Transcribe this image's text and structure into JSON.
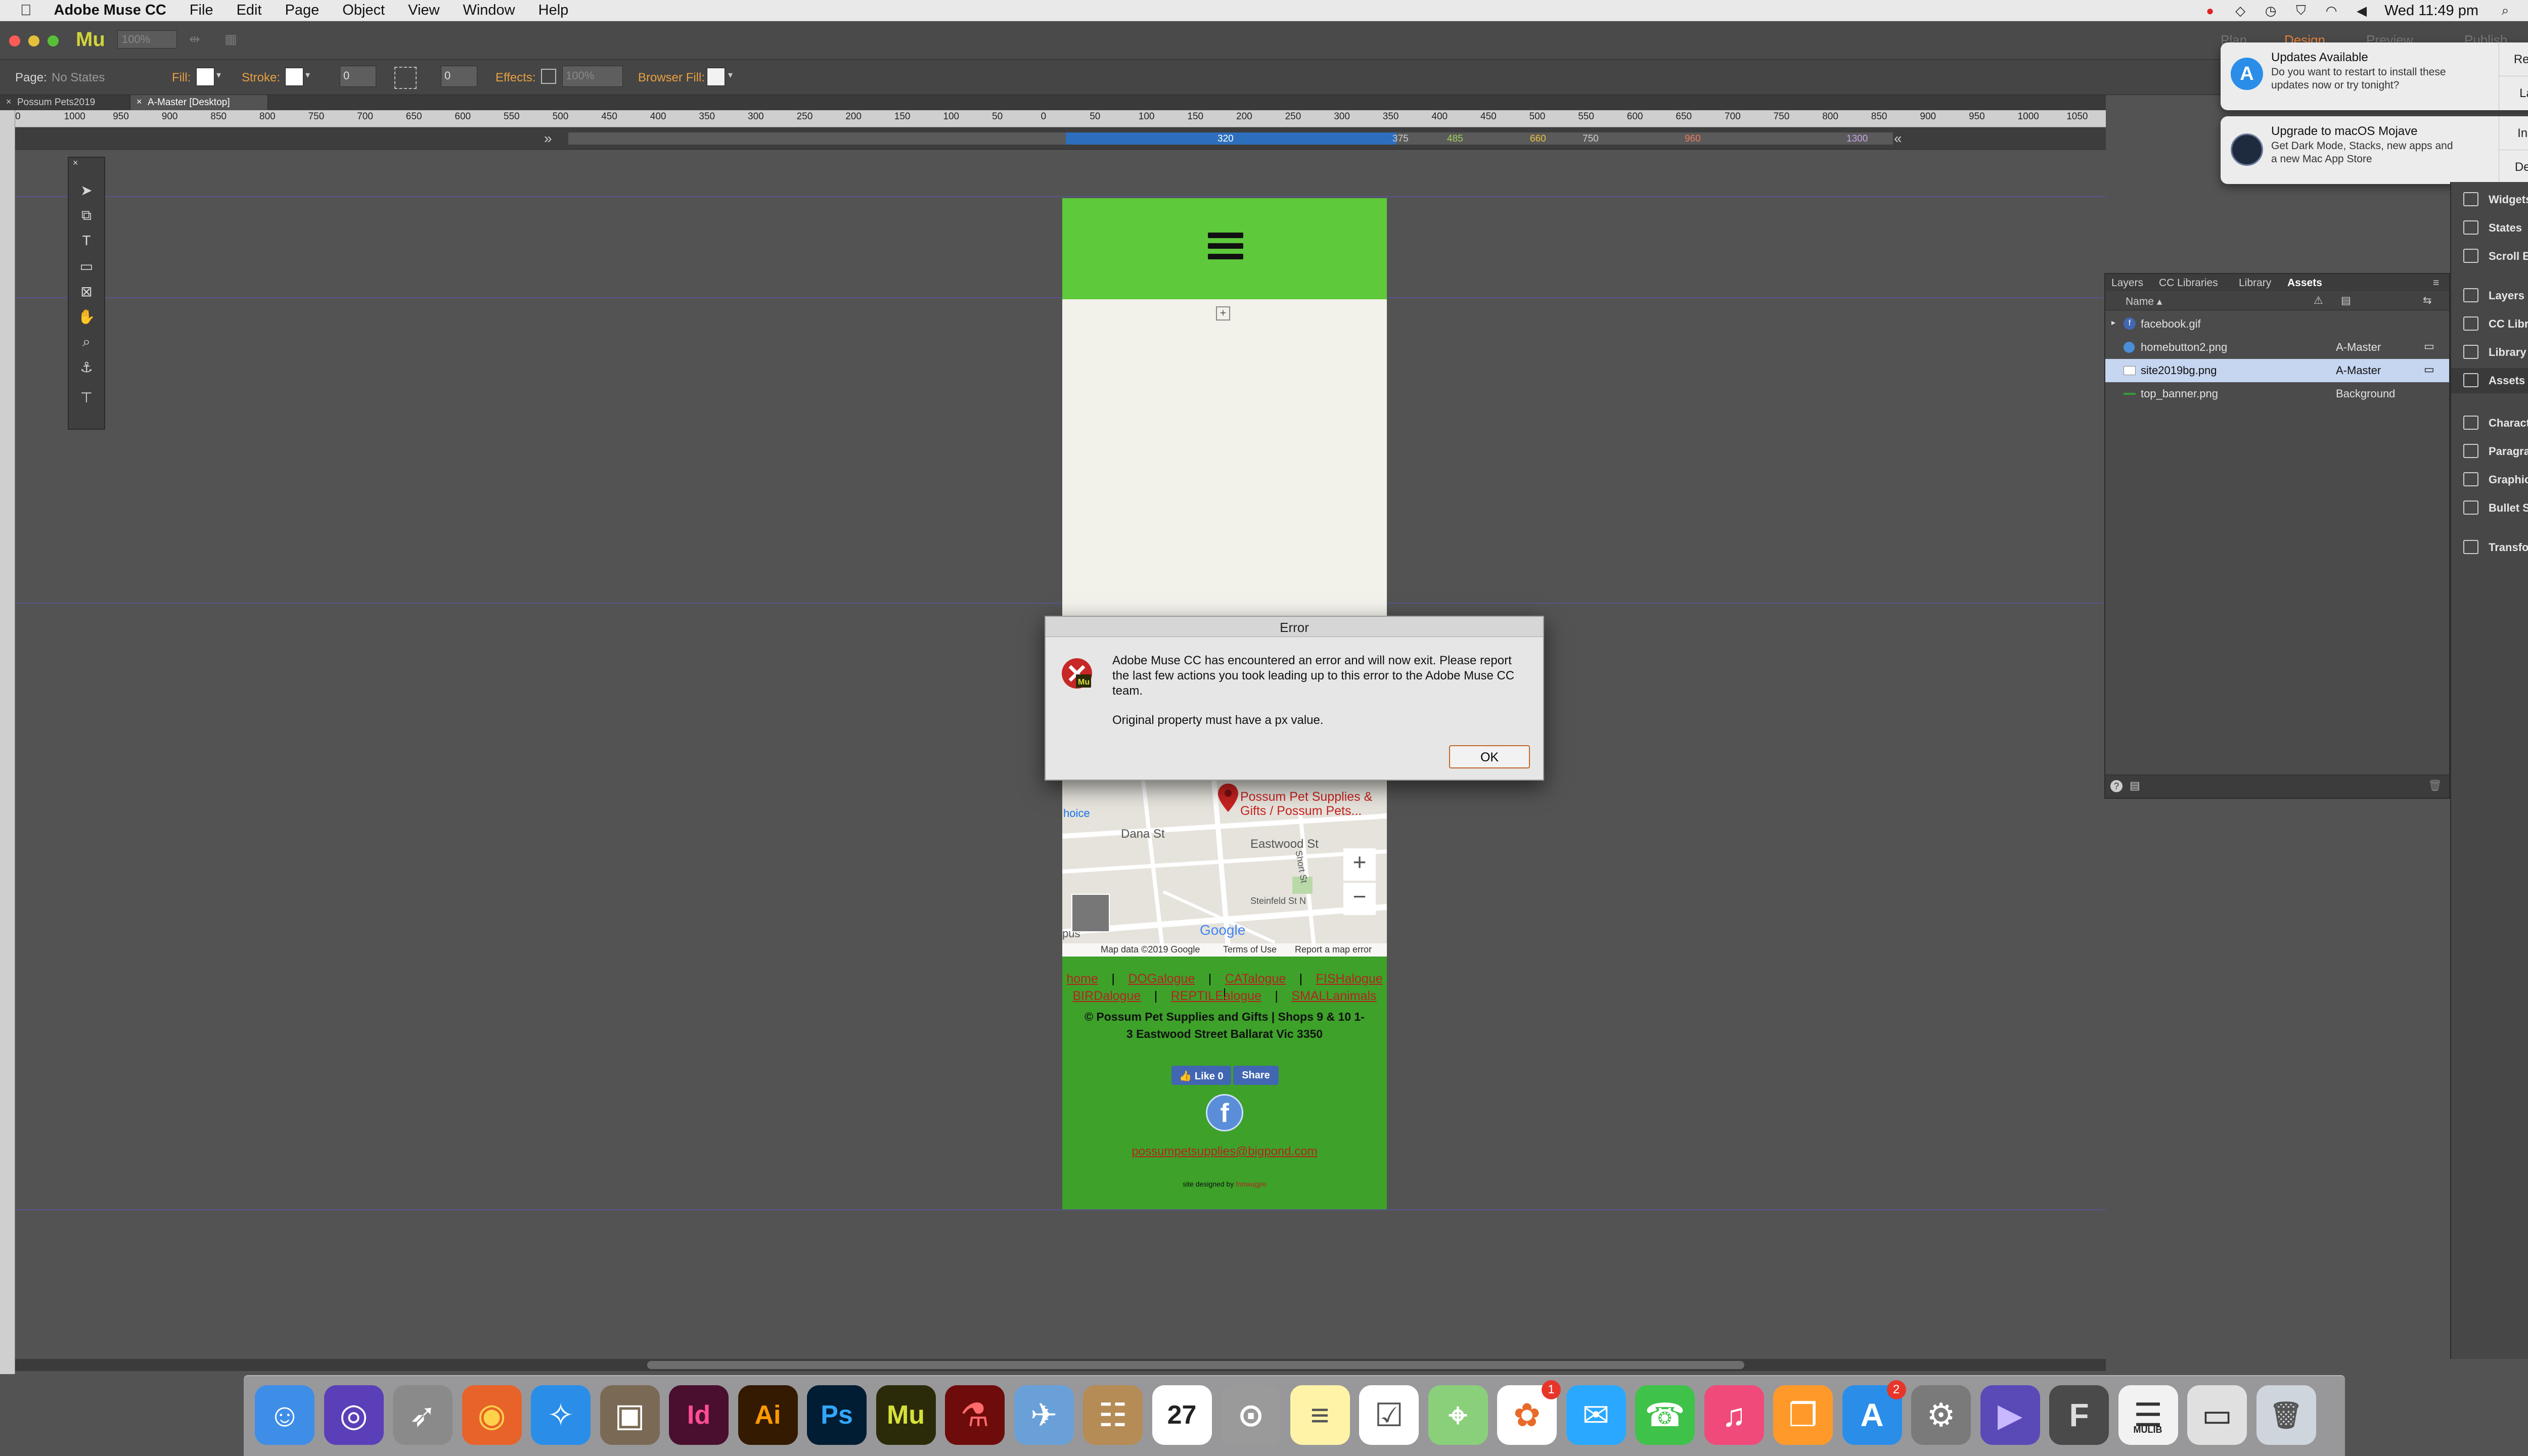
{
  "menubar": {
    "app_name": "Adobe Muse CC",
    "items": [
      "File",
      "Edit",
      "Page",
      "Object",
      "View",
      "Window",
      "Help"
    ],
    "clock": "Wed 11:49 pm"
  },
  "app": {
    "logo": "Mu",
    "zoom_value": "100%"
  },
  "controlbar": {
    "page_label": "Page:",
    "page_state": "No States",
    "fill_label": "Fill:",
    "stroke_label": "Stroke:",
    "stroke_width": "0",
    "corner_value": "0",
    "effects_label": "Effects:",
    "effects_value": "100%",
    "browser_fill_label": "Browser Fill:"
  },
  "doc_tabs": [
    {
      "label": "Possum Pets2019",
      "active": false
    },
    {
      "label": "A-Master [Desktop]",
      "active": true
    }
  ],
  "ruler": {
    "ticks": [
      "0",
      "1000",
      "950",
      "900",
      "850",
      "800",
      "750",
      "700",
      "650",
      "600",
      "550",
      "500",
      "450",
      "400",
      "350",
      "300",
      "250",
      "200",
      "150",
      "100",
      "50",
      "0",
      "50",
      "100",
      "150",
      "200",
      "250",
      "300",
      "350",
      "400",
      "450",
      "500",
      "550",
      "600",
      "650",
      "700",
      "750",
      "800",
      "850",
      "900",
      "950",
      "1000",
      "1050",
      "1100"
    ]
  },
  "breakpoints": {
    "active": "320",
    "values": [
      "375",
      "485",
      "660",
      "750",
      "960",
      "1300"
    ]
  },
  "page_mock": {
    "map_pin_label": "Possum Pet Supplies & Gifts / Possum Pets...",
    "map_street_1": "Dana St",
    "map_street_2": "Eastwood St",
    "map_street_3": "Steinfeld St N",
    "map_street_4": "Short St",
    "map_choice": "hoice",
    "map_left_frag": "pus",
    "map_google": "Google",
    "map_footer": [
      "Map data ©2019 Google",
      "Terms of Use",
      "Report a map error"
    ],
    "zoom_in": "+",
    "zoom_out": "−",
    "footer_links_1": [
      "home",
      "DOGalogue",
      "CATalogue",
      "FISHalogue"
    ],
    "footer_links_2": [
      "BIRDalogue",
      "REPTILEalogue",
      "SMALLanimals"
    ],
    "separator": "|",
    "copyright": "© Possum Pet Supplies and Gifts    |    Shops 9 & 10 1-3 Eastwood Street Ballarat Vic 3350",
    "like_button": "Like 0",
    "share_button": "Share",
    "fb_letter": "f",
    "email": "possumpetsupplies@bigpond.com",
    "designed_by": "site designed by",
    "designer": "fnnwugjre"
  },
  "dialog": {
    "title": "Error",
    "message": "Adobe Muse CC has encountered an error and will now exit. Please report the last few actions you took leading up to this error to the Adobe Muse CC team.",
    "detail": "Original property must have a px value.",
    "ok_label": "OK"
  },
  "notifications": [
    {
      "title": "Updates Available",
      "body": "Do you want to restart to install these updates now or try tonight?",
      "btn1": "Restart",
      "btn2": "Later"
    },
    {
      "title": "Upgrade to macOS Mojave",
      "body": "Get Dark Mode, Stacks, new apps and a new Mac App Store",
      "btn1": "Install",
      "btn2": "Details"
    }
  ],
  "top_right_tabs": [
    "Plan",
    "Design",
    "Preview",
    "Publish"
  ],
  "assets_panel": {
    "tabs": [
      "Layers",
      "CC Libraries",
      "Library",
      "Assets"
    ],
    "active_tab": "Assets",
    "column_name": "Name",
    "rows": [
      {
        "name": "facebook.gif",
        "page": "",
        "selected": false
      },
      {
        "name": "homebutton2.png",
        "page": "A-Master",
        "selected": false
      },
      {
        "name": "site2019bg.png",
        "page": "A-Master",
        "selected": true
      },
      {
        "name": "top_banner.png",
        "page": "Background",
        "selected": false
      }
    ]
  },
  "right_panel": {
    "items": [
      "Widgets Library",
      "States",
      "Scroll Effects",
      "Layers",
      "CC Libraries",
      "Library",
      "Assets",
      "Character Styles",
      "Paragraph Styl...",
      "Graphic Styles",
      "Bullet Styles",
      "Transform"
    ]
  },
  "dock": {
    "apps": [
      {
        "name": "Finder",
        "glyph": "☺",
        "bg": "#3e8ee8",
        "fg": "#fff"
      },
      {
        "name": "Siri",
        "glyph": "◎",
        "bg": "#5b3fb8",
        "fg": "#fff"
      },
      {
        "name": "Launchpad",
        "glyph": "➶",
        "bg": "#8a8a8a",
        "fg": "#fff"
      },
      {
        "name": "Firefox",
        "glyph": "◉",
        "bg": "#e8632a",
        "fg": "#ffd24a"
      },
      {
        "name": "Safari",
        "glyph": "✧",
        "bg": "#2a8ee8",
        "fg": "#fff"
      },
      {
        "name": "Photo Booth",
        "glyph": "▣",
        "bg": "#7a6a55",
        "fg": "#fff"
      },
      {
        "name": "InDesign",
        "glyph": "Id",
        "bg": "#4a0f2e",
        "fg": "#ff4d94"
      },
      {
        "name": "Illustrator",
        "glyph": "Ai",
        "bg": "#331a00",
        "fg": "#ff9a00"
      },
      {
        "name": "Photoshop",
        "glyph": "Ps",
        "bg": "#001d34",
        "fg": "#31a8ff"
      },
      {
        "name": "Muse",
        "glyph": "Mu",
        "bg": "#2b2b0a",
        "fg": "#d6e03a"
      },
      {
        "name": "Acrobat",
        "glyph": "⚗",
        "bg": "#6e0b0b",
        "fg": "#ff6a6a"
      },
      {
        "name": "Preview",
        "glyph": "✈",
        "bg": "#6aa0d8",
        "fg": "#fff"
      },
      {
        "name": "Contacts",
        "glyph": "☷",
        "bg": "#b58c55",
        "fg": "#fff"
      },
      {
        "name": "Calendar",
        "glyph": "27",
        "bg": "#ffffff",
        "fg": "#222"
      },
      {
        "name": "Screenshot",
        "glyph": "⊙",
        "bg": "#9a9a9a",
        "fg": "#fff"
      },
      {
        "name": "Notes",
        "glyph": "≡",
        "bg": "#fff3a8",
        "fg": "#555"
      },
      {
        "name": "Reminders",
        "glyph": "☑",
        "bg": "#ffffff",
        "fg": "#555"
      },
      {
        "name": "Maps",
        "glyph": "⌖",
        "bg": "#8ad07a",
        "fg": "#fff"
      },
      {
        "name": "Photos",
        "glyph": "✿",
        "bg": "#ffffff",
        "fg": "#e86a2a",
        "badge": "1"
      },
      {
        "name": "Messages",
        "glyph": "✉",
        "bg": "#2aa8ff",
        "fg": "#fff"
      },
      {
        "name": "FaceTime",
        "glyph": "☎",
        "bg": "#3fc24a",
        "fg": "#fff"
      },
      {
        "name": "iTunes",
        "glyph": "♫",
        "bg": "#f04a7a",
        "fg": "#fff"
      },
      {
        "name": "iBooks",
        "glyph": "❒",
        "bg": "#ff9a2a",
        "fg": "#fff"
      },
      {
        "name": "App Store",
        "glyph": "A",
        "bg": "#2a8ee8",
        "fg": "#fff",
        "badge": "2"
      },
      {
        "name": "System Preferences",
        "glyph": "⚙",
        "bg": "#7a7a7a",
        "fg": "#fff"
      },
      {
        "name": "Prime Video",
        "glyph": "▶",
        "bg": "#5a4ab8",
        "fg": "#c8b8ff"
      },
      {
        "name": "FontForge",
        "glyph": "F",
        "bg": "#4a4a4a",
        "fg": "#ddd"
      },
      {
        "name": "Downloads",
        "glyph": "☰",
        "bg": "#f2f2f2",
        "fg": "#333"
      },
      {
        "name": "Documents",
        "glyph": "▭",
        "bg": "#e0e0e0",
        "fg": "#333"
      },
      {
        "name": "Trash",
        "glyph": "🗑",
        "bg": "#cfd5dc",
        "fg": "#555"
      }
    ],
    "stack_label": "MULIB"
  },
  "colors": {
    "header_green": "#5ec93b",
    "footer_green": "#3da12a",
    "link_red": "#b3261e",
    "selection_blue": "#c6d6f0"
  }
}
